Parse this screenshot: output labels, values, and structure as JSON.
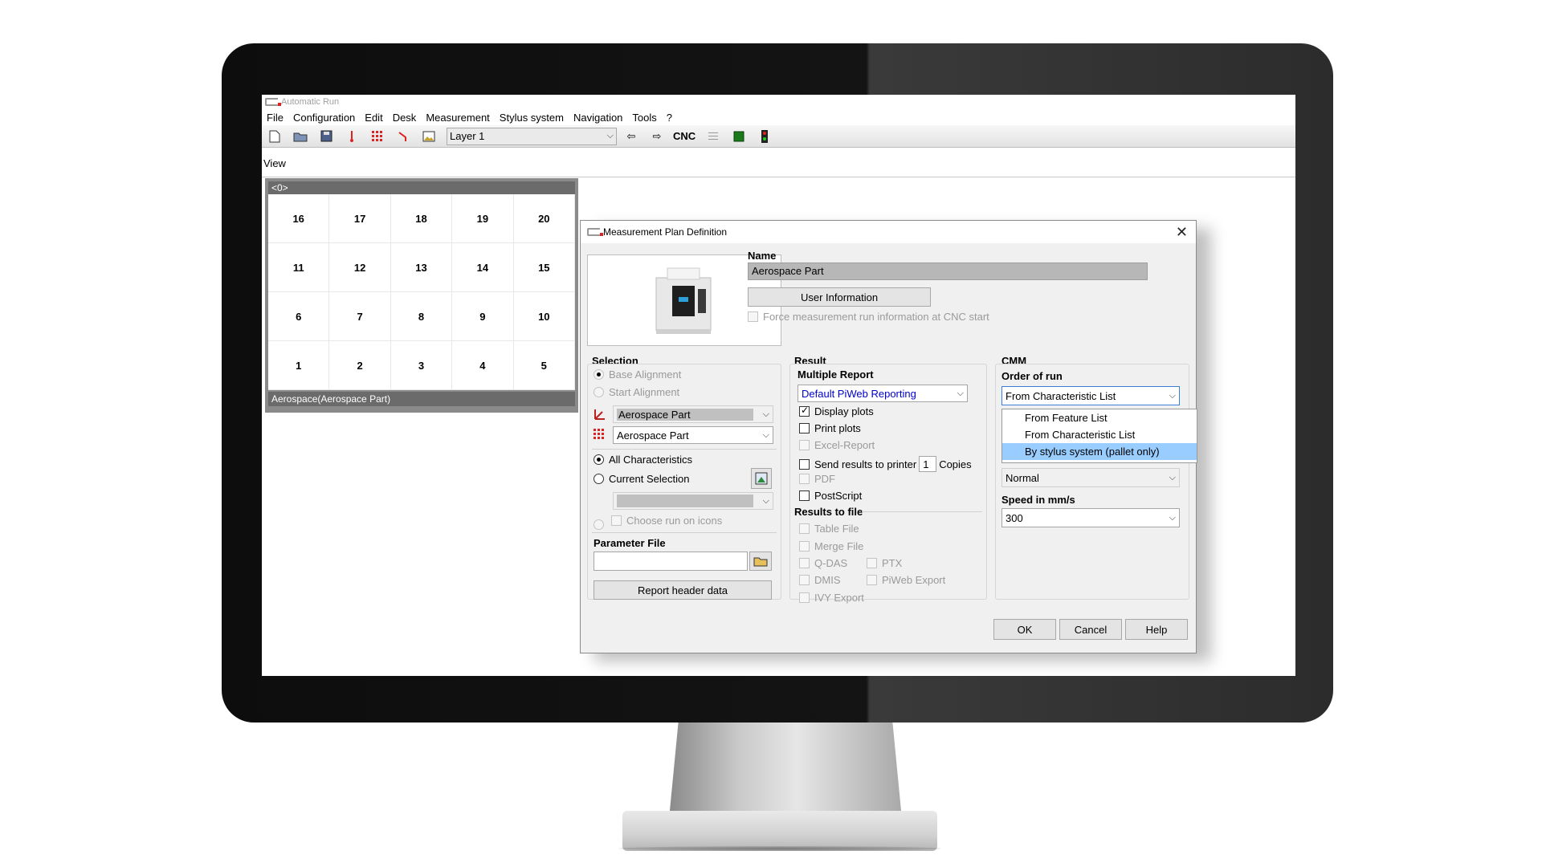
{
  "window": {
    "title": "Automatic Run"
  },
  "menu": [
    {
      "label": "File"
    },
    {
      "label": "Configuration"
    },
    {
      "label": "Edit"
    },
    {
      "label": "Desk"
    },
    {
      "label": "Measurement"
    },
    {
      "label": "Stylus system"
    },
    {
      "label": "Navigation"
    },
    {
      "label": "Tools"
    },
    {
      "label": "?"
    }
  ],
  "toolbar": {
    "layer_value": "Layer 1",
    "cnc_label": "CNC"
  },
  "view": {
    "label": "View",
    "pallet_header": "<0>",
    "pallet_cells": [
      "16",
      "17",
      "18",
      "19",
      "20",
      "11",
      "12",
      "13",
      "14",
      "15",
      "6",
      "7",
      "8",
      "9",
      "10",
      "1",
      "2",
      "3",
      "4",
      "5"
    ],
    "pallet_footer": "Aerospace(Aerospace Part)"
  },
  "dialog": {
    "title": "Measurement Plan Definition",
    "name_label": "Name",
    "name_value": "Aerospace Part",
    "user_info_button": "User Information",
    "force_info_label": "Force measurement run information at CNC start",
    "selection": {
      "heading": "Selection",
      "base_alignment": "Base Alignment",
      "start_alignment": "Start Alignment",
      "alignment_select": "Aerospace Part",
      "feature_select": "Aerospace Part",
      "all_characteristics": "All Characteristics",
      "current_selection": "Current Selection",
      "choose_run_on_icons": "Choose run on icons",
      "parameter_file_label": "Parameter File",
      "parameter_file_value": "",
      "report_header_button": "Report header data"
    },
    "result": {
      "heading": "Result",
      "multiple_report_label": "Multiple Report",
      "report_select": "Default PiWeb Reporting",
      "display_plots": "Display plots",
      "print_plots": "Print plots",
      "excel_report": "Excel-Report",
      "send_to_printer": "Send results to printer",
      "copies_value": "1",
      "copies_label": "Copies",
      "pdf": "PDF",
      "postscript": "PostScript",
      "results_to_file": "Results to file",
      "table_file": "Table File",
      "merge_file": "Merge File",
      "qdas": "Q-DAS",
      "ptx": "PTX",
      "dmis": "DMIS",
      "piweb_export": "PiWeb Export",
      "ivy_export": "IVY Export"
    },
    "cmm": {
      "heading": "CMM",
      "order_label": "Order of run",
      "order_value": "From Characteristic List",
      "order_options": [
        "From Feature List",
        "From Characteristic List",
        "By stylus system (pallet only)"
      ],
      "mode_value": "Normal",
      "speed_label": "Speed in mm/s",
      "speed_value": "300"
    },
    "buttons": {
      "ok": "OK",
      "cancel": "Cancel",
      "help": "Help"
    }
  },
  "colors": {
    "selection_highlight": "#99ccff",
    "link_blue": "#0000cc",
    "pallet_header": "#6b6b6b"
  }
}
